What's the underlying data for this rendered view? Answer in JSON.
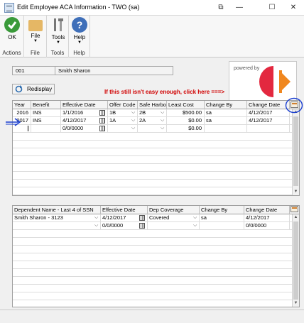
{
  "window": {
    "title": "Edit Employee ACA Information  -  TWO (sa)",
    "controls": {
      "restore_symbol": "⧉",
      "minimize_symbol": "—",
      "maximize_symbol": "☐",
      "close_symbol": "✕"
    }
  },
  "ribbon": {
    "groups": [
      {
        "label": "Actions",
        "buttons": [
          {
            "label": "OK",
            "icon": "checkmark-icon"
          }
        ]
      },
      {
        "label": "File",
        "buttons": [
          {
            "label": "File",
            "icon": "folder-icon",
            "dropdown": "▼"
          }
        ]
      },
      {
        "label": "Tools",
        "buttons": [
          {
            "label": "Tools",
            "icon": "tools-icon",
            "dropdown": "▼"
          }
        ]
      },
      {
        "label": "Help",
        "buttons": [
          {
            "label": "Help",
            "icon": "help-icon",
            "dropdown": "▼"
          }
        ]
      }
    ]
  },
  "employee": {
    "id": "001",
    "name": "Smith  Sharon"
  },
  "logo": {
    "text": "powered by",
    "colors": {
      "red": "#e3283f",
      "orange": "#f0871f"
    }
  },
  "redisplay_label": "Redisplay",
  "annotation": {
    "text": "If this still isn't easy enough, click here ===>",
    "color": "#d00000",
    "circle_color": "#1a3fd1",
    "arrow_color": "#1a3fd1"
  },
  "aca_grid": {
    "headers": [
      "Year",
      "Benefit",
      "Effective Date",
      "Offer Code",
      "Safe Harbor",
      "Least Cost",
      "Change By",
      "Change Date"
    ],
    "rows": [
      {
        "year": "2016",
        "benefit": "INS",
        "effective_date": "1/1/2016",
        "offer_code": "1B",
        "safe_harbor": "2B",
        "least_cost": "$500.00",
        "change_by": "sa",
        "change_date": "4/12/2017"
      },
      {
        "year": "2017",
        "benefit": "INS",
        "effective_date": "4/12/2017",
        "offer_code": "1A",
        "safe_harbor": "2A",
        "least_cost": "$0.00",
        "change_by": "sa",
        "change_date": "4/12/2017"
      },
      {
        "year": "",
        "benefit": "",
        "effective_date": "0/0/0000",
        "offer_code": "",
        "safe_harbor": "",
        "least_cost": "$0.00",
        "change_by": "",
        "change_date": ""
      }
    ],
    "empty_rows": 8
  },
  "dependent_grid": {
    "headers": [
      "Dependent Name - Last 4 of SSN",
      "Effective Date",
      "Dep Coverage",
      "Change By",
      "Change Date"
    ],
    "rows": [
      {
        "name": "Smith  Sharon - 3123",
        "effective_date": "4/12/2017",
        "coverage": "Covered",
        "change_by": "sa",
        "change_date": "4/12/2017"
      },
      {
        "name": "",
        "effective_date": "0/0/0000",
        "coverage": "",
        "change_by": "",
        "change_date": "0/0/0000"
      }
    ],
    "empty_rows": 9
  }
}
